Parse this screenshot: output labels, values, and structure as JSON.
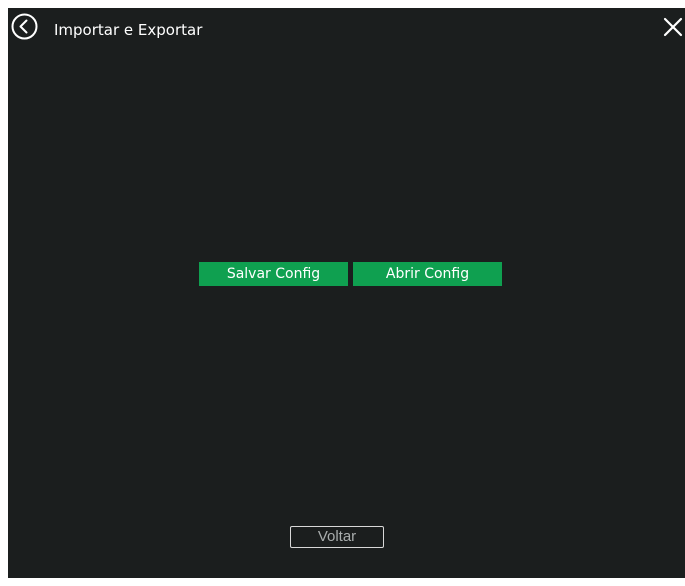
{
  "window": {
    "title": "Importar e Exportar",
    "back_icon": "circle-chevron-left-icon",
    "close_icon": "close-x-icon"
  },
  "actions": {
    "save_config_label": "Salvar Config",
    "open_config_label": "Abrir Config"
  },
  "footer": {
    "back_label": "Voltar"
  },
  "colors": {
    "background": "#1b1e1e",
    "accent_green": "#0fa050",
    "text": "#ffffff",
    "muted_text": "#a9adad"
  }
}
